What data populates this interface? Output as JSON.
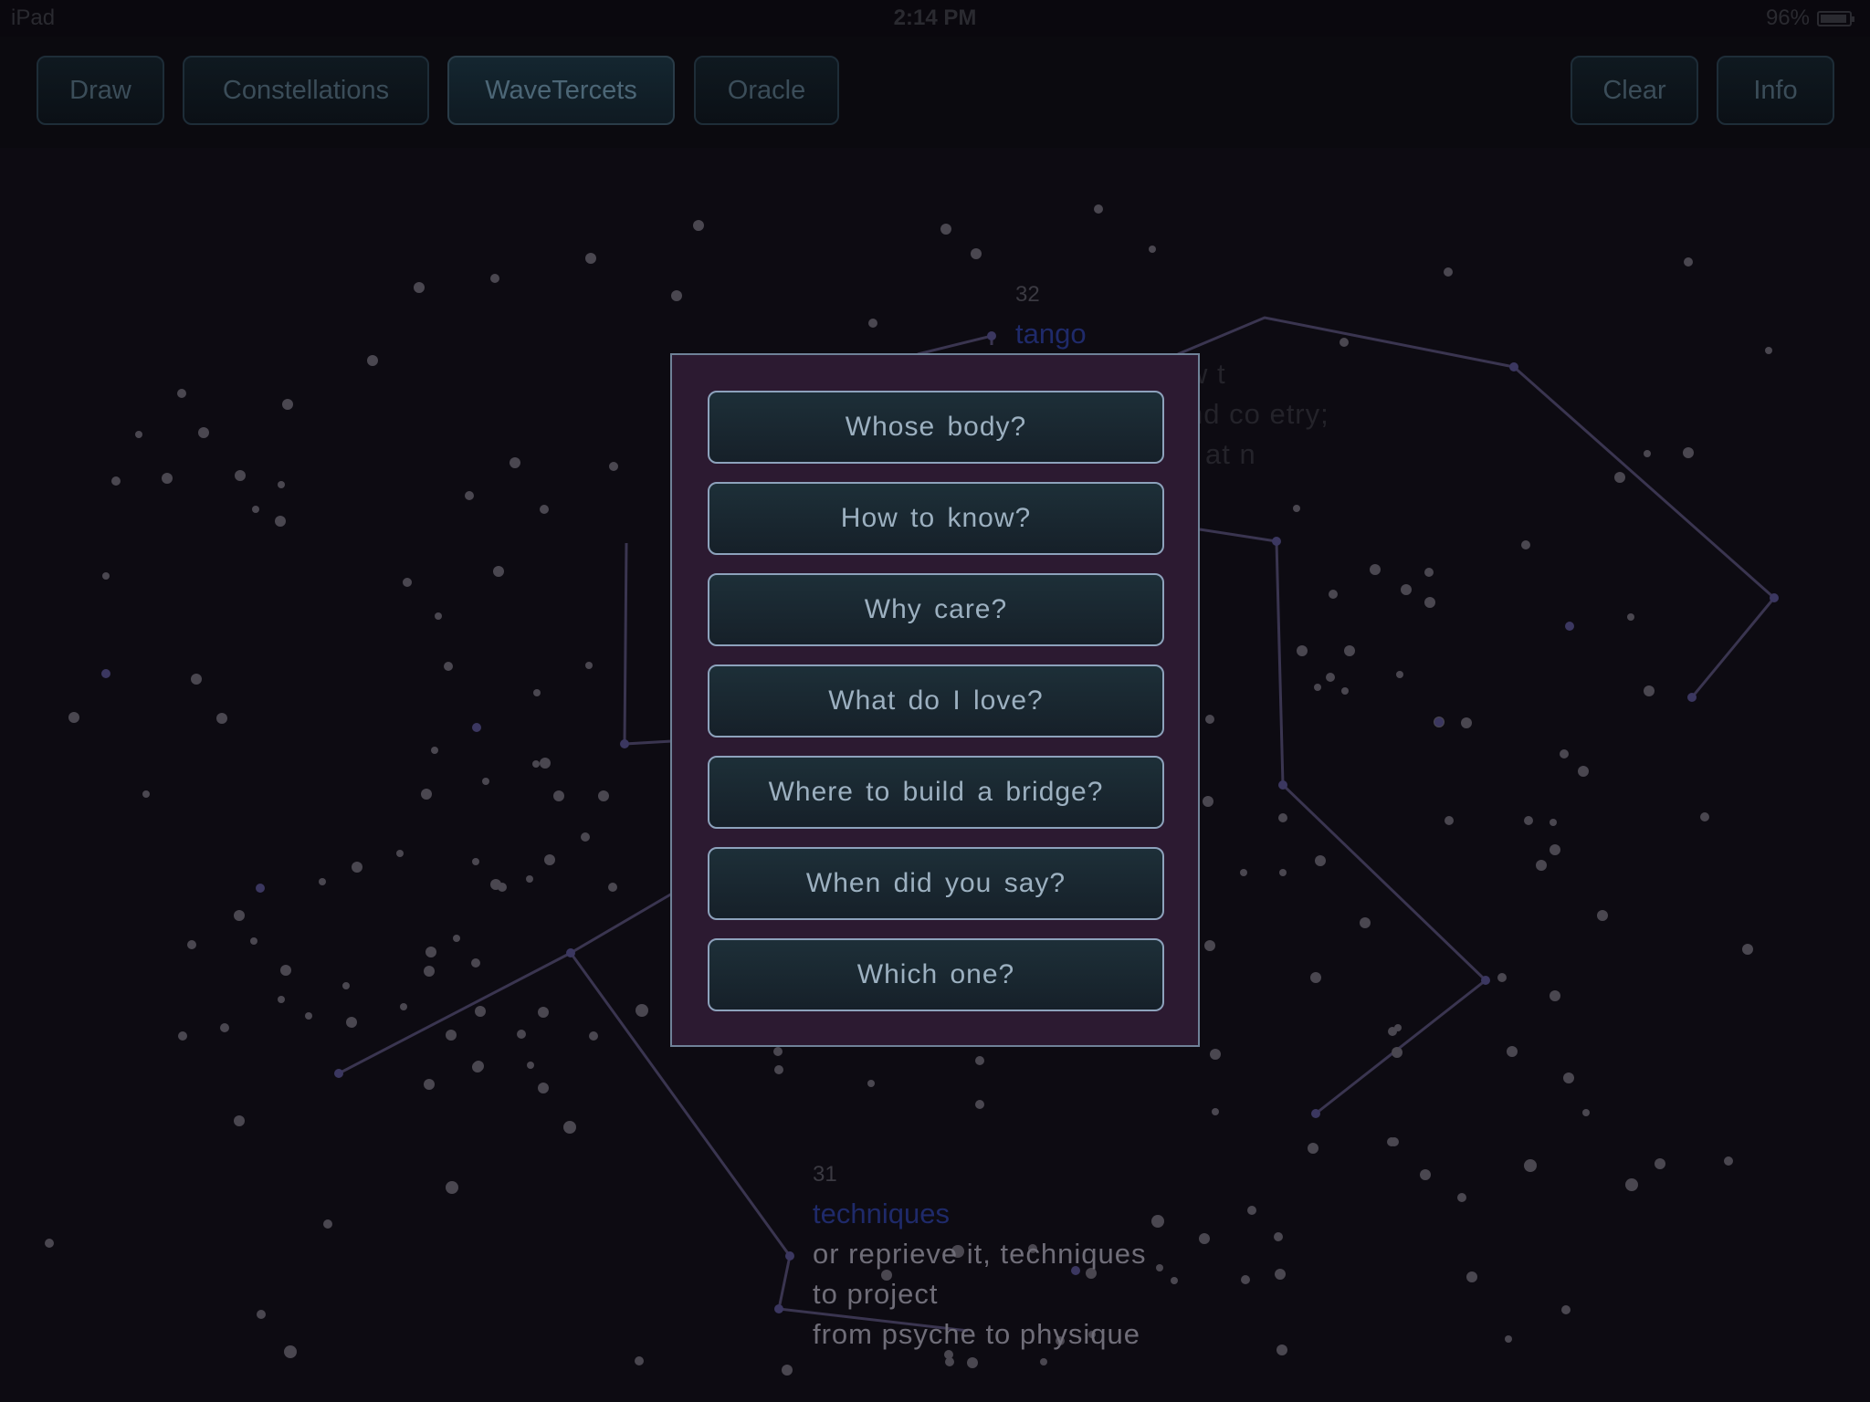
{
  "status_bar": {
    "device": "iPad",
    "time": "2:14 PM",
    "battery": "96%"
  },
  "toolbar": {
    "draw": "Draw",
    "constellations": "Constellations",
    "wavetercets": "WaveTercets",
    "oracle": "Oracle",
    "clear": "Clear",
    "info": "Info"
  },
  "verses": {
    "v32": {
      "number": "32",
      "title": "tango",
      "lines": [
        "w  t",
        "nd   co   etry;",
        "at  n"
      ]
    },
    "v31": {
      "number": "31",
      "title": "techniques",
      "lines": [
        "or reprieve it, techniques",
        "to project",
        "from psyche to physique"
      ]
    }
  },
  "oracle_modal": {
    "questions": [
      "Whose body?",
      "How to know?",
      "Why care?",
      "What do I love?",
      "Where to build a bridge?",
      "When did you say?",
      "Which one?"
    ]
  },
  "colors": {
    "background": "#0d0b12",
    "modal_background": "#2c1a31",
    "modal_border": "#6f8298",
    "button_text": "#9cb0c0",
    "constellation_line": "#3a3550",
    "verse_title": "#1f2a6a"
  }
}
